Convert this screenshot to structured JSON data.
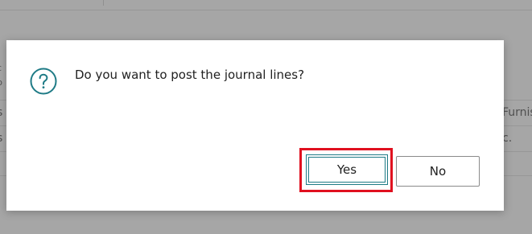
{
  "dialog": {
    "message": "Do you want to post the journal lines?",
    "icon": "question-circle-icon",
    "accent_color": "#1f7b86",
    "highlight_color": "#e0101f",
    "buttons": {
      "yes_label": "Yes",
      "no_label": "No"
    }
  },
  "background": {
    "left_fragments": [
      "c",
      "p",
      "s",
      "s"
    ],
    "right_fragments": [
      "Furnis",
      "c."
    ]
  }
}
